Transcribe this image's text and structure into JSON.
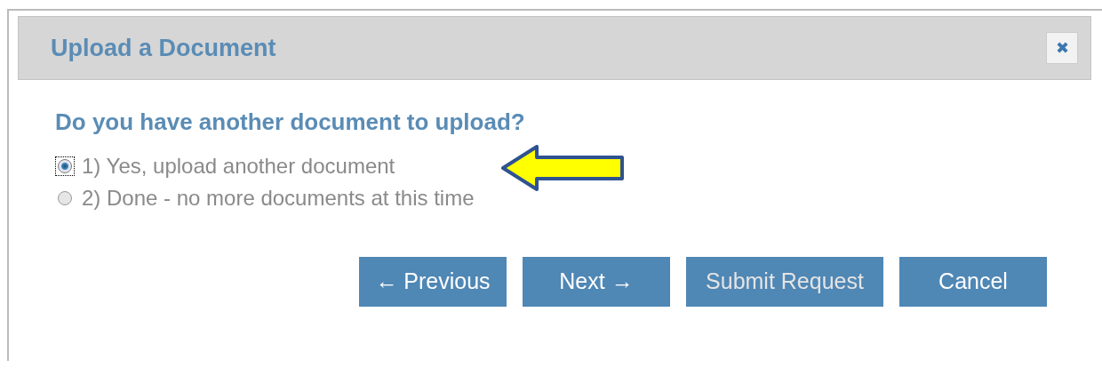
{
  "dialog": {
    "title": "Upload a Document",
    "close": "✖"
  },
  "question": "Do you have another document to upload?",
  "options": [
    {
      "label": "1) Yes, upload another document",
      "selected": true
    },
    {
      "label": "2) Done - no more documents at this time",
      "selected": false
    }
  ],
  "buttons": [
    {
      "label": "← Previous",
      "disabled": false
    },
    {
      "label": "Next →",
      "disabled": false
    },
    {
      "label": "Submit Request",
      "disabled": true
    },
    {
      "label": "Cancel",
      "disabled": false
    }
  ]
}
